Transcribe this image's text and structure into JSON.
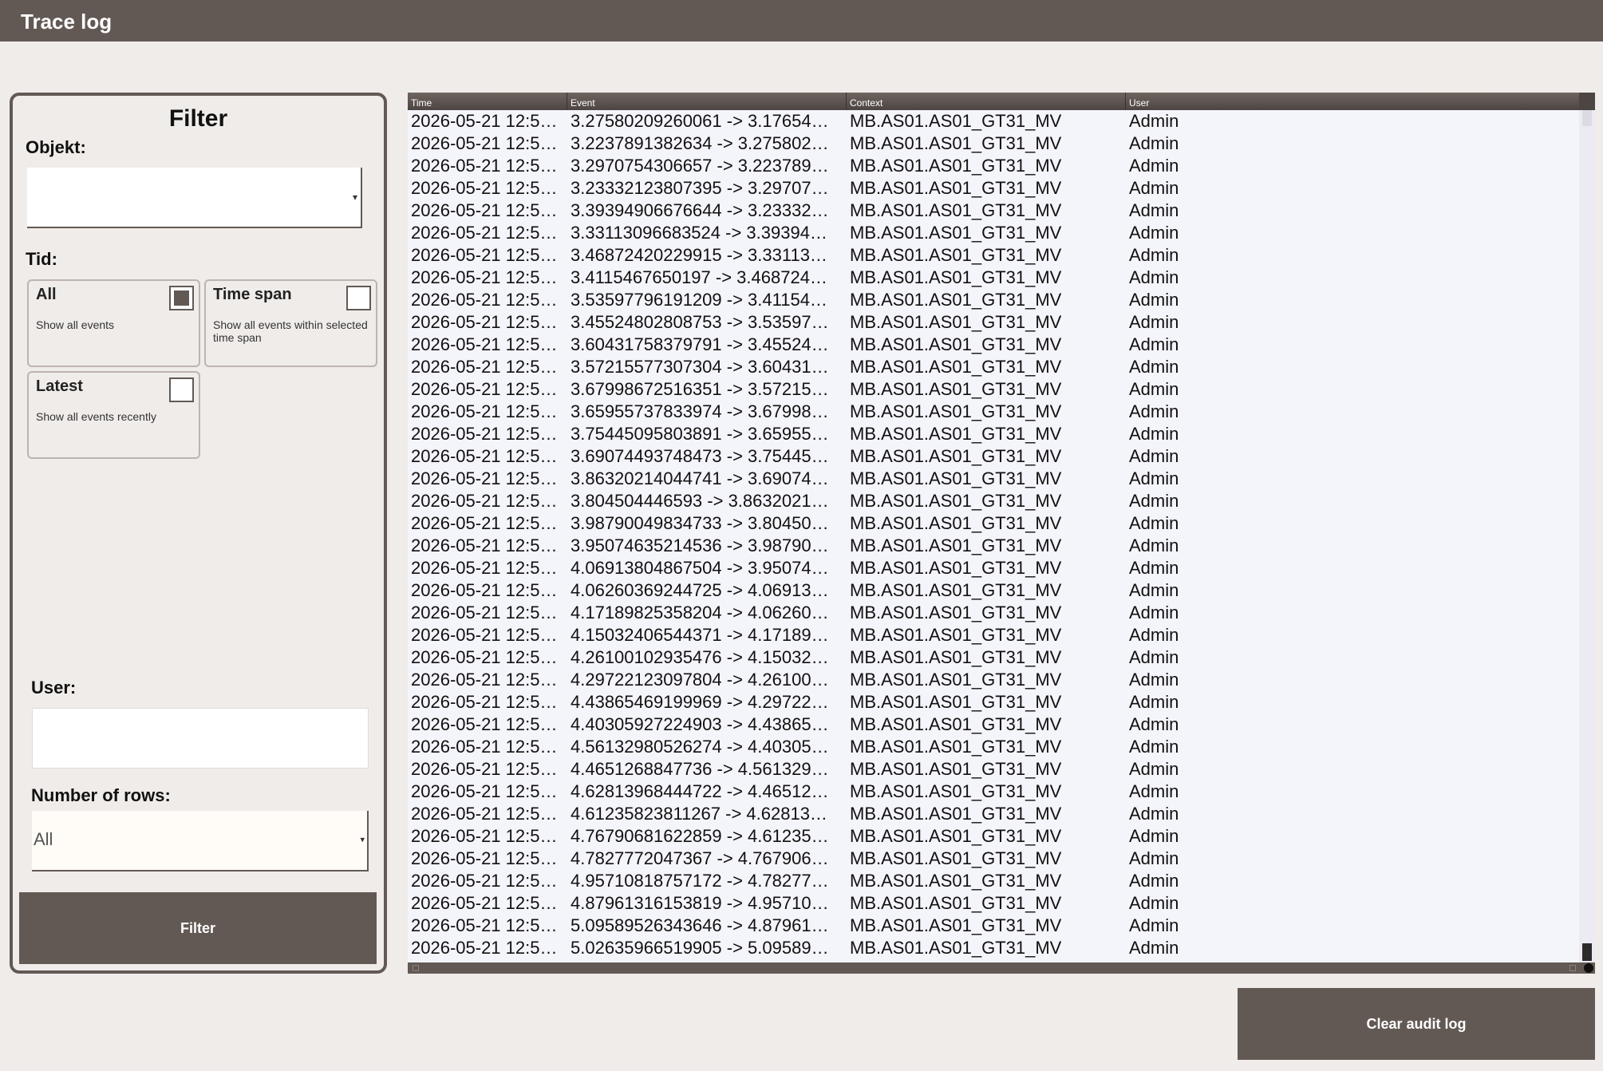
{
  "window": {
    "title": "Trace log"
  },
  "filter": {
    "title": "Filter",
    "object_label": "Objekt:",
    "object_value": "",
    "time_label": "Tid:",
    "options": {
      "all": {
        "title": "All",
        "desc": "Show all events",
        "checked": true
      },
      "timespan": {
        "title": "Time span",
        "desc": "Show all events within selected time span",
        "checked": false
      },
      "latest": {
        "title": "Latest",
        "desc": "Show all events recently",
        "checked": false
      }
    },
    "user_label": "User:",
    "user_value": "",
    "rows_label": "Number of rows:",
    "rows_value": "All",
    "filter_button": "Filter"
  },
  "table": {
    "columns": [
      "Time",
      "Event",
      "Context",
      "User"
    ],
    "rows": [
      [
        "2026-05-21 12:5…",
        "3.27580209260061 -> 3.17654…",
        "MB.AS01.AS01_GT31_MV",
        "Admin"
      ],
      [
        "2026-05-21 12:5…",
        "3.2237891382634 -> 3.275802…",
        "MB.AS01.AS01_GT31_MV",
        "Admin"
      ],
      [
        "2026-05-21 12:5…",
        "3.2970754306657 -> 3.223789…",
        "MB.AS01.AS01_GT31_MV",
        "Admin"
      ],
      [
        "2026-05-21 12:5…",
        "3.23332123807395 -> 3.29707…",
        "MB.AS01.AS01_GT31_MV",
        "Admin"
      ],
      [
        "2026-05-21 12:5…",
        "3.39394906676644 -> 3.23332…",
        "MB.AS01.AS01_GT31_MV",
        "Admin"
      ],
      [
        "2026-05-21 12:5…",
        "3.33113096683524 -> 3.39394…",
        "MB.AS01.AS01_GT31_MV",
        "Admin"
      ],
      [
        "2026-05-21 12:5…",
        "3.46872420229915 -> 3.33113…",
        "MB.AS01.AS01_GT31_MV",
        "Admin"
      ],
      [
        "2026-05-21 12:5…",
        "3.4115467650197 -> 3.468724…",
        "MB.AS01.AS01_GT31_MV",
        "Admin"
      ],
      [
        "2026-05-21 12:5…",
        "3.53597796191209 -> 3.41154…",
        "MB.AS01.AS01_GT31_MV",
        "Admin"
      ],
      [
        "2026-05-21 12:5…",
        "3.45524802808753 -> 3.53597…",
        "MB.AS01.AS01_GT31_MV",
        "Admin"
      ],
      [
        "2026-05-21 12:5…",
        "3.60431758379791 -> 3.45524…",
        "MB.AS01.AS01_GT31_MV",
        "Admin"
      ],
      [
        "2026-05-21 12:5…",
        "3.57215577307304 -> 3.60431…",
        "MB.AS01.AS01_GT31_MV",
        "Admin"
      ],
      [
        "2026-05-21 12:5…",
        "3.67998672516351 -> 3.57215…",
        "MB.AS01.AS01_GT31_MV",
        "Admin"
      ],
      [
        "2026-05-21 12:5…",
        "3.65955737833974 -> 3.67998…",
        "MB.AS01.AS01_GT31_MV",
        "Admin"
      ],
      [
        "2026-05-21 12:5…",
        "3.75445095803891 -> 3.65955…",
        "MB.AS01.AS01_GT31_MV",
        "Admin"
      ],
      [
        "2026-05-21 12:5…",
        "3.69074493748473 -> 3.75445…",
        "MB.AS01.AS01_GT31_MV",
        "Admin"
      ],
      [
        "2026-05-21 12:5…",
        "3.86320214044741 -> 3.69074…",
        "MB.AS01.AS01_GT31_MV",
        "Admin"
      ],
      [
        "2026-05-21 12:5…",
        "3.804504446593 -> 3.8632021…",
        "MB.AS01.AS01_GT31_MV",
        "Admin"
      ],
      [
        "2026-05-21 12:5…",
        "3.98790049834733 -> 3.80450…",
        "MB.AS01.AS01_GT31_MV",
        "Admin"
      ],
      [
        "2026-05-21 12:5…",
        "3.95074635214536 -> 3.98790…",
        "MB.AS01.AS01_GT31_MV",
        "Admin"
      ],
      [
        "2026-05-21 12:5…",
        "4.06913804867504 -> 3.95074…",
        "MB.AS01.AS01_GT31_MV",
        "Admin"
      ],
      [
        "2026-05-21 12:5…",
        "4.06260369244725 -> 4.06913…",
        "MB.AS01.AS01_GT31_MV",
        "Admin"
      ],
      [
        "2026-05-21 12:5…",
        "4.17189825358204 -> 4.06260…",
        "MB.AS01.AS01_GT31_MV",
        "Admin"
      ],
      [
        "2026-05-21 12:5…",
        "4.15032406544371 -> 4.17189…",
        "MB.AS01.AS01_GT31_MV",
        "Admin"
      ],
      [
        "2026-05-21 12:5…",
        "4.26100102935476 -> 4.15032…",
        "MB.AS01.AS01_GT31_MV",
        "Admin"
      ],
      [
        "2026-05-21 12:5…",
        "4.29722123097804 -> 4.26100…",
        "MB.AS01.AS01_GT31_MV",
        "Admin"
      ],
      [
        "2026-05-21 12:5…",
        "4.43865469199969 -> 4.29722…",
        "MB.AS01.AS01_GT31_MV",
        "Admin"
      ],
      [
        "2026-05-21 12:5…",
        "4.40305927224903 -> 4.43865…",
        "MB.AS01.AS01_GT31_MV",
        "Admin"
      ],
      [
        "2026-05-21 12:5…",
        "4.56132980526274 -> 4.40305…",
        "MB.AS01.AS01_GT31_MV",
        "Admin"
      ],
      [
        "2026-05-21 12:5…",
        "4.4651268847736 -> 4.561329…",
        "MB.AS01.AS01_GT31_MV",
        "Admin"
      ],
      [
        "2026-05-21 12:5…",
        "4.62813968444722 -> 4.46512…",
        "MB.AS01.AS01_GT31_MV",
        "Admin"
      ],
      [
        "2026-05-21 12:5…",
        "4.61235823811267 -> 4.62813…",
        "MB.AS01.AS01_GT31_MV",
        "Admin"
      ],
      [
        "2026-05-21 12:5…",
        "4.76790681622859 -> 4.61235…",
        "MB.AS01.AS01_GT31_MV",
        "Admin"
      ],
      [
        "2026-05-21 12:5…",
        "4.7827772047367 -> 4.767906…",
        "MB.AS01.AS01_GT31_MV",
        "Admin"
      ],
      [
        "2026-05-21 12:5…",
        "4.95710818757172 -> 4.78277…",
        "MB.AS01.AS01_GT31_MV",
        "Admin"
      ],
      [
        "2026-05-21 12:5…",
        "4.87961316153819 -> 4.95710…",
        "MB.AS01.AS01_GT31_MV",
        "Admin"
      ],
      [
        "2026-05-21 12:5…",
        "5.09589526343646 -> 4.87961…",
        "MB.AS01.AS01_GT31_MV",
        "Admin"
      ],
      [
        "2026-05-21 12:5…",
        "5.02635966519905 -> 5.09589…",
        "MB.AS01.AS01_GT31_MV",
        "Admin"
      ]
    ]
  },
  "clear_button": "Clear audit log",
  "icons": {
    "dropdown": "chevron-down-icon"
  },
  "colors": {
    "brand": "#625955",
    "background": "#f0ecea"
  }
}
